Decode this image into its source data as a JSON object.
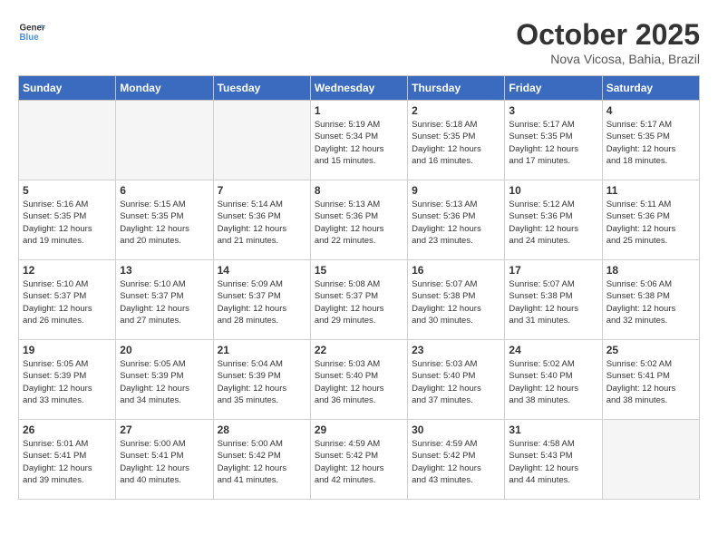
{
  "header": {
    "logo_line1": "General",
    "logo_line2": "Blue",
    "title": "October 2025",
    "subtitle": "Nova Vicosa, Bahia, Brazil"
  },
  "days_of_week": [
    "Sunday",
    "Monday",
    "Tuesday",
    "Wednesday",
    "Thursday",
    "Friday",
    "Saturday"
  ],
  "weeks": [
    [
      {
        "day": "",
        "info": ""
      },
      {
        "day": "",
        "info": ""
      },
      {
        "day": "",
        "info": ""
      },
      {
        "day": "1",
        "info": "Sunrise: 5:19 AM\nSunset: 5:34 PM\nDaylight: 12 hours\nand 15 minutes."
      },
      {
        "day": "2",
        "info": "Sunrise: 5:18 AM\nSunset: 5:35 PM\nDaylight: 12 hours\nand 16 minutes."
      },
      {
        "day": "3",
        "info": "Sunrise: 5:17 AM\nSunset: 5:35 PM\nDaylight: 12 hours\nand 17 minutes."
      },
      {
        "day": "4",
        "info": "Sunrise: 5:17 AM\nSunset: 5:35 PM\nDaylight: 12 hours\nand 18 minutes."
      }
    ],
    [
      {
        "day": "5",
        "info": "Sunrise: 5:16 AM\nSunset: 5:35 PM\nDaylight: 12 hours\nand 19 minutes."
      },
      {
        "day": "6",
        "info": "Sunrise: 5:15 AM\nSunset: 5:35 PM\nDaylight: 12 hours\nand 20 minutes."
      },
      {
        "day": "7",
        "info": "Sunrise: 5:14 AM\nSunset: 5:36 PM\nDaylight: 12 hours\nand 21 minutes."
      },
      {
        "day": "8",
        "info": "Sunrise: 5:13 AM\nSunset: 5:36 PM\nDaylight: 12 hours\nand 22 minutes."
      },
      {
        "day": "9",
        "info": "Sunrise: 5:13 AM\nSunset: 5:36 PM\nDaylight: 12 hours\nand 23 minutes."
      },
      {
        "day": "10",
        "info": "Sunrise: 5:12 AM\nSunset: 5:36 PM\nDaylight: 12 hours\nand 24 minutes."
      },
      {
        "day": "11",
        "info": "Sunrise: 5:11 AM\nSunset: 5:36 PM\nDaylight: 12 hours\nand 25 minutes."
      }
    ],
    [
      {
        "day": "12",
        "info": "Sunrise: 5:10 AM\nSunset: 5:37 PM\nDaylight: 12 hours\nand 26 minutes."
      },
      {
        "day": "13",
        "info": "Sunrise: 5:10 AM\nSunset: 5:37 PM\nDaylight: 12 hours\nand 27 minutes."
      },
      {
        "day": "14",
        "info": "Sunrise: 5:09 AM\nSunset: 5:37 PM\nDaylight: 12 hours\nand 28 minutes."
      },
      {
        "day": "15",
        "info": "Sunrise: 5:08 AM\nSunset: 5:37 PM\nDaylight: 12 hours\nand 29 minutes."
      },
      {
        "day": "16",
        "info": "Sunrise: 5:07 AM\nSunset: 5:38 PM\nDaylight: 12 hours\nand 30 minutes."
      },
      {
        "day": "17",
        "info": "Sunrise: 5:07 AM\nSunset: 5:38 PM\nDaylight: 12 hours\nand 31 minutes."
      },
      {
        "day": "18",
        "info": "Sunrise: 5:06 AM\nSunset: 5:38 PM\nDaylight: 12 hours\nand 32 minutes."
      }
    ],
    [
      {
        "day": "19",
        "info": "Sunrise: 5:05 AM\nSunset: 5:39 PM\nDaylight: 12 hours\nand 33 minutes."
      },
      {
        "day": "20",
        "info": "Sunrise: 5:05 AM\nSunset: 5:39 PM\nDaylight: 12 hours\nand 34 minutes."
      },
      {
        "day": "21",
        "info": "Sunrise: 5:04 AM\nSunset: 5:39 PM\nDaylight: 12 hours\nand 35 minutes."
      },
      {
        "day": "22",
        "info": "Sunrise: 5:03 AM\nSunset: 5:40 PM\nDaylight: 12 hours\nand 36 minutes."
      },
      {
        "day": "23",
        "info": "Sunrise: 5:03 AM\nSunset: 5:40 PM\nDaylight: 12 hours\nand 37 minutes."
      },
      {
        "day": "24",
        "info": "Sunrise: 5:02 AM\nSunset: 5:40 PM\nDaylight: 12 hours\nand 38 minutes."
      },
      {
        "day": "25",
        "info": "Sunrise: 5:02 AM\nSunset: 5:41 PM\nDaylight: 12 hours\nand 38 minutes."
      }
    ],
    [
      {
        "day": "26",
        "info": "Sunrise: 5:01 AM\nSunset: 5:41 PM\nDaylight: 12 hours\nand 39 minutes."
      },
      {
        "day": "27",
        "info": "Sunrise: 5:00 AM\nSunset: 5:41 PM\nDaylight: 12 hours\nand 40 minutes."
      },
      {
        "day": "28",
        "info": "Sunrise: 5:00 AM\nSunset: 5:42 PM\nDaylight: 12 hours\nand 41 minutes."
      },
      {
        "day": "29",
        "info": "Sunrise: 4:59 AM\nSunset: 5:42 PM\nDaylight: 12 hours\nand 42 minutes."
      },
      {
        "day": "30",
        "info": "Sunrise: 4:59 AM\nSunset: 5:42 PM\nDaylight: 12 hours\nand 43 minutes."
      },
      {
        "day": "31",
        "info": "Sunrise: 4:58 AM\nSunset: 5:43 PM\nDaylight: 12 hours\nand 44 minutes."
      },
      {
        "day": "",
        "info": ""
      }
    ]
  ]
}
